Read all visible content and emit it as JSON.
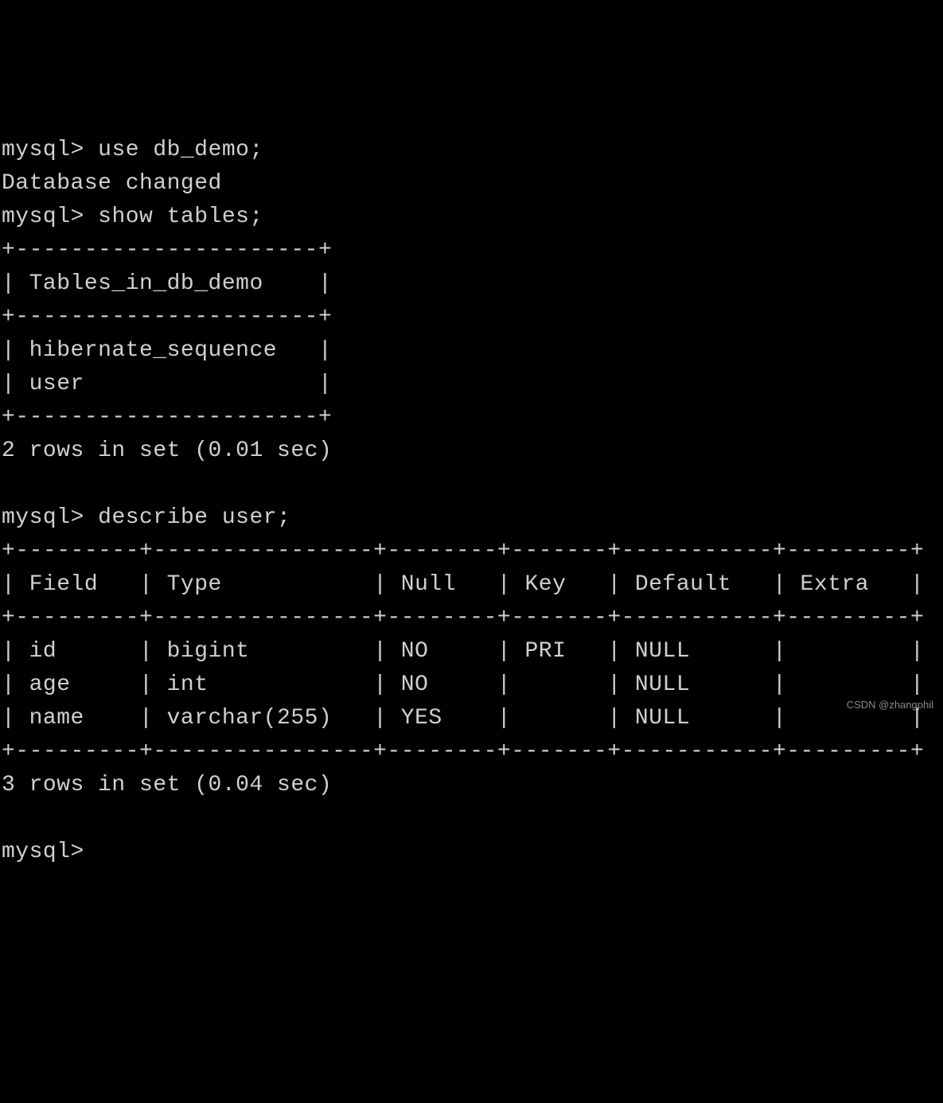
{
  "prompt": "mysql>",
  "cmd1": "use db_demo;",
  "resp1": "Database changed",
  "cmd2": "show tables;",
  "tables_header": "Tables_in_db_demo",
  "tables_rows": [
    "hibernate_sequence",
    "user"
  ],
  "tables_summary": "2 rows in set (0.01 sec)",
  "cmd3": "describe user;",
  "describe_headers": [
    "Field",
    "Type",
    "Null",
    "Key",
    "Default",
    "Extra"
  ],
  "describe_rows": [
    {
      "Field": "id",
      "Type": "bigint",
      "Null": "NO",
      "Key": "PRI",
      "Default": "NULL",
      "Extra": ""
    },
    {
      "Field": "age",
      "Type": "int",
      "Null": "NO",
      "Key": "",
      "Default": "NULL",
      "Extra": ""
    },
    {
      "Field": "name",
      "Type": "varchar(255)",
      "Null": "YES",
      "Key": "",
      "Default": "NULL",
      "Extra": ""
    }
  ],
  "describe_summary": "3 rows in set (0.04 sec)",
  "watermark": "CSDN @zhangphil",
  "layout": {
    "tables_col_width": 20,
    "describe_col_widths": [
      7,
      14,
      6,
      5,
      9,
      7
    ]
  }
}
